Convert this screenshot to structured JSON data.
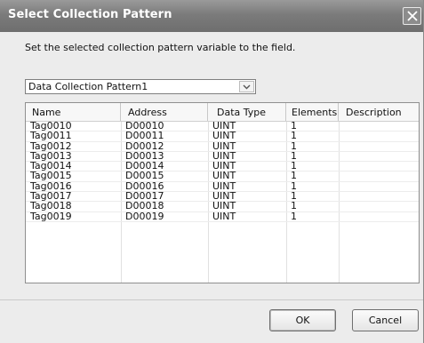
{
  "window": {
    "title": "Select Collection Pattern",
    "instruction": "Set the selected collection pattern variable to the field."
  },
  "pattern_select": {
    "value": "Data Collection Pattern1"
  },
  "table": {
    "columns": [
      "Name",
      "Address",
      "Data Type",
      "Elements",
      "Description"
    ],
    "rows": [
      [
        "Tag0010",
        "D00010",
        "UINT",
        "1",
        ""
      ],
      [
        "Tag0011",
        "D00011",
        "UINT",
        "1",
        ""
      ],
      [
        "Tag0012",
        "D00012",
        "UINT",
        "1",
        ""
      ],
      [
        "Tag0013",
        "D00013",
        "UINT",
        "1",
        ""
      ],
      [
        "Tag0014",
        "D00014",
        "UINT",
        "1",
        ""
      ],
      [
        "Tag0015",
        "D00015",
        "UINT",
        "1",
        ""
      ],
      [
        "Tag0016",
        "D00016",
        "UINT",
        "1",
        ""
      ],
      [
        "Tag0017",
        "D00017",
        "UINT",
        "1",
        ""
      ],
      [
        "Tag0018",
        "D00018",
        "UINT",
        "1",
        ""
      ],
      [
        "Tag0019",
        "D00019",
        "UINT",
        "1",
        ""
      ]
    ]
  },
  "buttons": {
    "ok_label": "OK",
    "cancel_label": "Cancel"
  }
}
